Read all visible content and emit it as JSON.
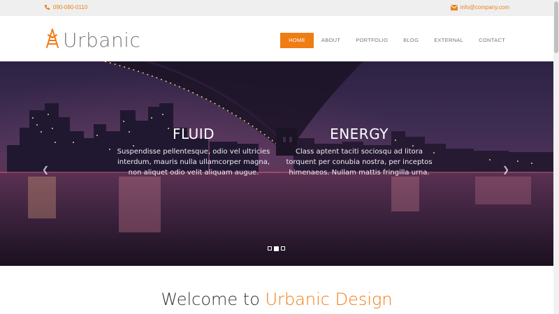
{
  "topbar": {
    "phone": "090-080-0110",
    "email": "info@company.com"
  },
  "brand": {
    "name": "Urbanic",
    "accent_color": "#f07c14"
  },
  "nav": {
    "items": [
      {
        "label": "HOME",
        "active": true
      },
      {
        "label": "ABOUT",
        "active": false
      },
      {
        "label": "PORTFOLIO",
        "active": false
      },
      {
        "label": "BLOG",
        "active": false
      },
      {
        "label": "EXTERNAL",
        "active": false
      },
      {
        "label": "CONTACT",
        "active": false
      }
    ]
  },
  "hero": {
    "slides": [
      {
        "title": "FLUID",
        "text": "Suspendisse pellentesque, odio vel ultricies interdum, mauris nulla ullamcorper magna, non aliquet odio velit aliquam augue."
      },
      {
        "title": "ENERGY",
        "text": "Class aptent taciti sociosqu ad litora torquent per conubia nostra, per inceptos himenaeos. Nullam mattis fringilla urna."
      }
    ],
    "prev_icon": "chevron-left-icon",
    "next_icon": "chevron-right-icon",
    "indicator_count": 3,
    "indicator_active": 2
  },
  "welcome": {
    "prefix": "Welcome to ",
    "highlight": "Urbanic Design"
  }
}
